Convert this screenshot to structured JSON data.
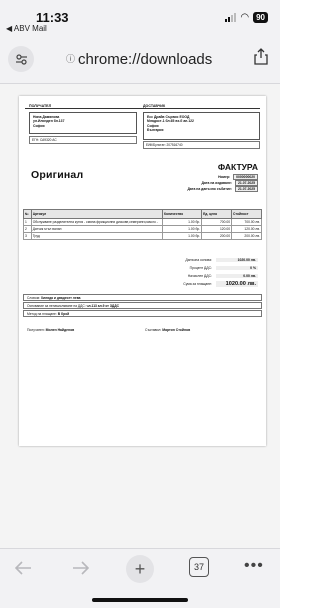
{
  "status": {
    "time": "11:33",
    "back_app": "◀ ABV Mail",
    "battery": "90"
  },
  "address_bar": {
    "url": "chrome://downloads"
  },
  "invoice": {
    "buyer_label": "ПОЛУЧАТЕЛ",
    "supplier_label": "ДОСТАВЧИК",
    "buyer": {
      "name": "Нина Дамянова",
      "address": "ул.Илинден бл.137",
      "city": "София",
      "id_label": "ЕГН:",
      "id_value": "СА9320 АС"
    },
    "supplier": {
      "name": "Есс Драйв Сървис ЕООД",
      "address": "Младост-1 бл.65 вх.б ап.122",
      "city": "София",
      "country": "България",
      "vat_label": "ЕИК/Булстат:",
      "vat_value": "207516740"
    },
    "copy_label": "Оригинал",
    "title": "ФАКТУРА",
    "number_label": "Номер:",
    "number": "0000000020",
    "issue_date_label": "Дата на издаване:",
    "issue_date": "21.07.2025",
    "tax_date_label": "Дата на данъчно събитие:",
    "tax_date": "21.07.2025",
    "columns": {
      "no": "№",
      "article": "Артикул",
      "qty": "Количество",
      "unit_price": "Ед. цена",
      "amount": "Стойност"
    },
    "items": [
      {
        "no": "1",
        "article": "Обслужване разделителна кутия - смяна фрикционни дискове,семеринги,масло -",
        "qty": "1.00 бр.",
        "unit_price": "700.00",
        "amount": "700.00 лв."
      },
      {
        "no": "2",
        "article": "Датчик ъгъл валан",
        "qty": "1.00 бр.",
        "unit_price": "120.00",
        "amount": "120.00 лв."
      },
      {
        "no": "3",
        "article": "Труд",
        "qty": "1.00 бр.",
        "unit_price": "200.00",
        "amount": "200.00 лв."
      }
    ],
    "totals": {
      "tax_base_label": "Данъчна основа:",
      "tax_base": "1020.00 лв.",
      "vat_pct_label": "Процент ДДС:",
      "vat_pct": "0 %",
      "vat_amount_label": "Начислен ДДС:",
      "vat_amount": "0.00 лв.",
      "total_label": "Сума за плащане:",
      "total": "1020.00 лв."
    },
    "in_words_label": "Словом:",
    "in_words": "Хиляда и двадесет лева",
    "vat_basis_label": "Основание за неначисляване на ДДС:",
    "vat_basis": "чл.113 ал.9 от ЗДДС",
    "payment_label": "Метод на плащане:",
    "payment": "В брой",
    "receiver_label": "Получател:",
    "receiver": "Милен Найденов",
    "author_label": "Съставил:",
    "author": "Мартин Стойнов"
  },
  "toolbar": {
    "tabs_count": "37"
  }
}
